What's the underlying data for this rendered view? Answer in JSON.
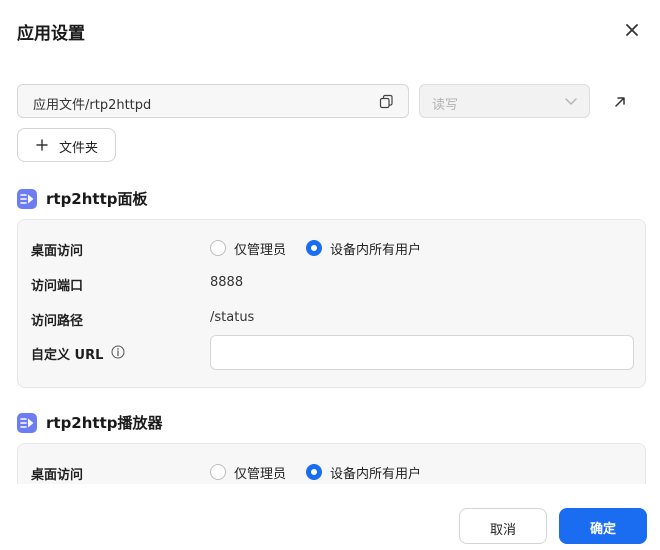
{
  "dialog": {
    "title": "应用设置"
  },
  "folder": {
    "path": "应用文件/rtp2httpd",
    "permission": "读写",
    "add_folder_label": "文件夹"
  },
  "sections": [
    {
      "title": "rtp2http面板",
      "desktop_access_label": "桌面访问",
      "radio_admin_label": "仅管理员",
      "radio_all_label": "设备内所有用户",
      "selected": "all",
      "port_label": "访问端口",
      "port_value": "8888",
      "path_label": "访问路径",
      "path_value": "/status",
      "custom_url_label": "自定义 URL",
      "custom_url_value": ""
    },
    {
      "title": "rtp2http播放器",
      "desktop_access_label": "桌面访问",
      "radio_admin_label": "仅管理员",
      "radio_all_label": "设备内所有用户",
      "selected": "all"
    }
  ],
  "footer": {
    "cancel_label": "取消",
    "confirm_label": "确定"
  },
  "colors": {
    "accent": "#1a6df0",
    "section_icon": "#6b7cf5"
  }
}
